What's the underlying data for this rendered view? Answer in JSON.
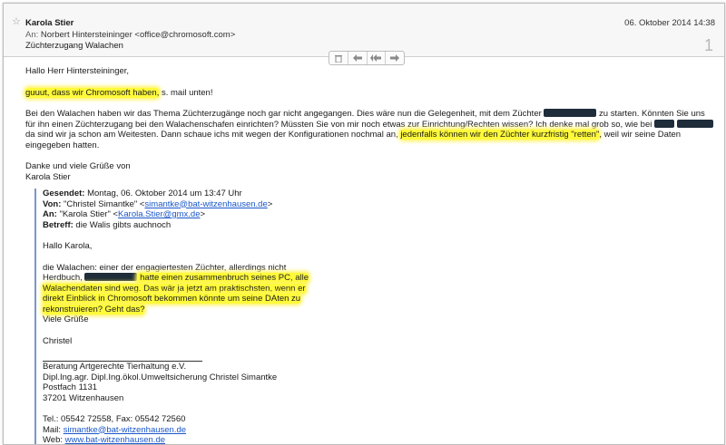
{
  "header": {
    "sender": "Karola Stier",
    "date": "06. Oktober 2014 14:38",
    "to_label": "An:",
    "to_value": "Norbert Hintersteininger <office@chromosoft.com>",
    "subject": "Züchterzugang Walachen",
    "message_count": "1"
  },
  "toolbar": {
    "delete_icon": "trash-icon",
    "reply_icon": "reply-icon",
    "reply_all_icon": "reply-all-icon",
    "forward_icon": "forward-icon"
  },
  "body": {
    "greeting": "Hallo Herr Hintersteininger,",
    "line1_hl": "guuut, dass wir Chromosoft haben,",
    "line1_rest": " s. mail unten!",
    "p2_a": "Bei den Walachen haben wir das Thema Züchterzugänge noch gar nicht angegangen. Dies wäre nun die Gelegenheit, mit dem Züchter ",
    "p2_b": " zu starten. Könnten Sie uns für ihn einen Züchterzugang bei den Walachenschafen einrichten? Müssten Sie von mir noch etwas zur Einrichtung/Rechten wissen? Ich denke mal grob so, wie bei ",
    "p2_c": " da sind wir ja schon am Weitesten. Dann schaue ichs mit wegen der Konfigurationen nochmal an, ",
    "p2_hl": "jedenfalls können wir den Züchter kurzfristig \"retten\"",
    "p2_d": ", weil wir seine Daten eingegeben hatten.",
    "closing": "Danke und viele Grüße von",
    "signature": "Karola Stier"
  },
  "quote": {
    "sent_label": "Gesendet:",
    "sent_value": " Montag, 06. Oktober 2014 um 13:47 Uhr",
    "from_label": "Von:",
    "from_name": " \"Christel Simantke\" <",
    "from_email": "simantke@bat-witzenhausen.de",
    "from_close": ">",
    "to_label": "An:",
    "to_name": " \"Karola Stier\" <",
    "to_email": "Karola.Stier@gmx.de",
    "to_close": ">",
    "subject_label": "Betreff:",
    "subject_value": " die Walis gibts auchnoch",
    "greeting": "Hallo Karola,",
    "p1_a": "die Walachen: einer der engagiertesten Züchter, allerdings nicht",
    "p1_b": "Herdbuch, ",
    "p1_hl1": " hatte einen zusammenbruch seines PC, alle",
    "p1_hl2": "Walachendaten sind weg. Das wär ja jetzt am praktischsten, wenn er",
    "p1_hl3": "direkt Einblick in Chromosoft bekommen könnte um seine DAten zu",
    "p1_hl4": "rekonstruieren? Geht das?",
    "regards": "Viele Grüße",
    "name": "Christel",
    "org": "Beratung Artgerechte Tierhaltung e.V.",
    "title": "Dipl.Ing.agr. Dipl.Ing.ökol.Umweltsicherung Christel Simantke",
    "postbox": "Postfach 1131",
    "city": "37201 Witzenhausen",
    "phone": "Tel.: 05542 72558, Fax: 05542 72560",
    "mail_label": "Mail: ",
    "mail_value": "simantke@bat-witzenhausen.de",
    "web_label": "Web: ",
    "web_value": "www.bat-witzenhausen.de"
  }
}
